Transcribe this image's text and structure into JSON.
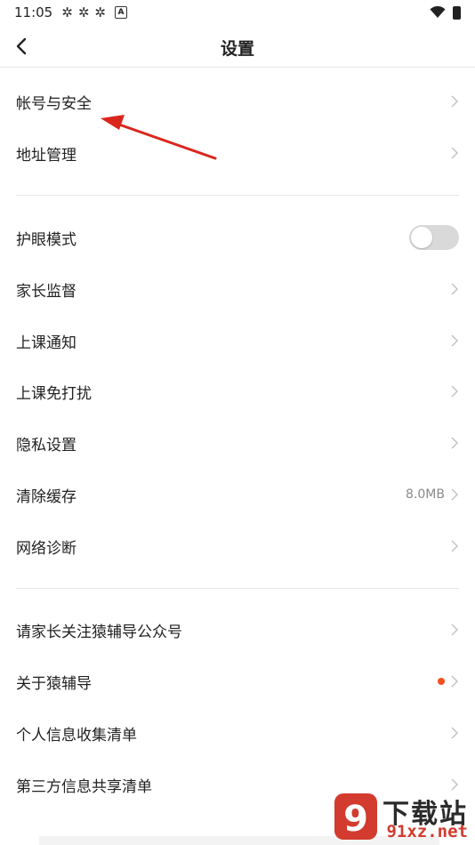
{
  "status_bar": {
    "time": "11:05",
    "badge": "A"
  },
  "header": {
    "title": "设置"
  },
  "groups": [
    {
      "items": [
        {
          "label": "帐号与安全"
        },
        {
          "label": "地址管理"
        }
      ]
    },
    {
      "items": [
        {
          "label": "护眼模式",
          "toggle": false
        },
        {
          "label": "家长监督"
        },
        {
          "label": "上课通知"
        },
        {
          "label": "上课免打扰"
        },
        {
          "label": "隐私设置"
        },
        {
          "label": "清除缓存",
          "value": "8.0MB"
        },
        {
          "label": "网络诊断"
        }
      ]
    },
    {
      "items": [
        {
          "label": "请家长关注猿辅导公众号"
        },
        {
          "label": "关于猿辅导",
          "badge_dot": true
        },
        {
          "label": "个人信息收集清单"
        },
        {
          "label": "第三方信息共享清单"
        }
      ]
    }
  ],
  "watermark": {
    "line1": "下载站",
    "line2": "91xz.net",
    "mark": "9"
  },
  "colors": {
    "dot": "#f2501c",
    "arrow": "#d9261c",
    "toggle_off": "#d9d9d9"
  }
}
